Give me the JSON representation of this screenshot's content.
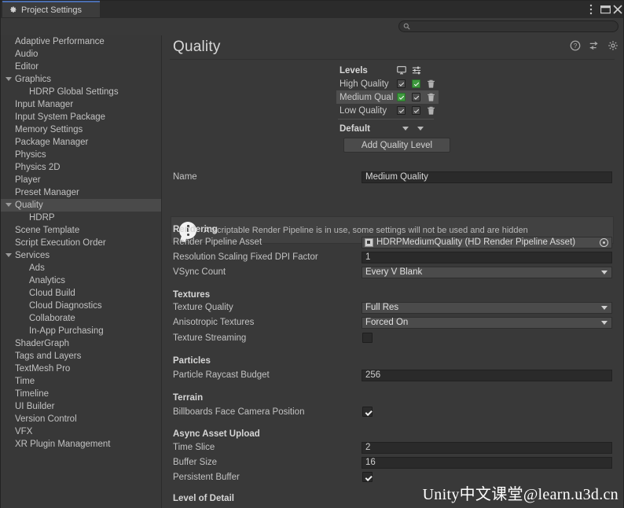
{
  "window": {
    "tab_label": "Project Settings",
    "tab_icon": "gear-icon",
    "controls": [
      {
        "name": "window-menu-icon",
        "glyph": "kebab-menu"
      },
      {
        "name": "window-maximize-icon",
        "glyph": "maximize"
      },
      {
        "name": "window-close-icon",
        "glyph": "close"
      }
    ]
  },
  "search": {
    "value": "",
    "placeholder": "",
    "icon": "search-icon"
  },
  "sidebar": {
    "items": [
      {
        "label": "Adaptive Performance",
        "indent": 0,
        "foldout": false,
        "selected": false
      },
      {
        "label": "Audio",
        "indent": 0,
        "foldout": false,
        "selected": false
      },
      {
        "label": "Editor",
        "indent": 0,
        "foldout": false,
        "selected": false
      },
      {
        "label": "Graphics",
        "indent": 0,
        "foldout": true,
        "selected": false
      },
      {
        "label": "HDRP Global Settings",
        "indent": 1,
        "foldout": false,
        "selected": false
      },
      {
        "label": "Input Manager",
        "indent": 0,
        "foldout": false,
        "selected": false
      },
      {
        "label": "Input System Package",
        "indent": 0,
        "foldout": false,
        "selected": false
      },
      {
        "label": "Memory Settings",
        "indent": 0,
        "foldout": false,
        "selected": false
      },
      {
        "label": "Package Manager",
        "indent": 0,
        "foldout": false,
        "selected": false
      },
      {
        "label": "Physics",
        "indent": 0,
        "foldout": false,
        "selected": false
      },
      {
        "label": "Physics 2D",
        "indent": 0,
        "foldout": false,
        "selected": false
      },
      {
        "label": "Player",
        "indent": 0,
        "foldout": false,
        "selected": false
      },
      {
        "label": "Preset Manager",
        "indent": 0,
        "foldout": false,
        "selected": false
      },
      {
        "label": "Quality",
        "indent": 0,
        "foldout": true,
        "selected": true
      },
      {
        "label": "HDRP",
        "indent": 1,
        "foldout": false,
        "selected": false
      },
      {
        "label": "Scene Template",
        "indent": 0,
        "foldout": false,
        "selected": false
      },
      {
        "label": "Script Execution Order",
        "indent": 0,
        "foldout": false,
        "selected": false
      },
      {
        "label": "Services",
        "indent": 0,
        "foldout": true,
        "selected": false
      },
      {
        "label": "Ads",
        "indent": 1,
        "foldout": false,
        "selected": false
      },
      {
        "label": "Analytics",
        "indent": 1,
        "foldout": false,
        "selected": false
      },
      {
        "label": "Cloud Build",
        "indent": 1,
        "foldout": false,
        "selected": false
      },
      {
        "label": "Cloud Diagnostics",
        "indent": 1,
        "foldout": false,
        "selected": false
      },
      {
        "label": "Collaborate",
        "indent": 1,
        "foldout": false,
        "selected": false
      },
      {
        "label": "In-App Purchasing",
        "indent": 1,
        "foldout": false,
        "selected": false
      },
      {
        "label": "ShaderGraph",
        "indent": 0,
        "foldout": false,
        "selected": false
      },
      {
        "label": "Tags and Layers",
        "indent": 0,
        "foldout": false,
        "selected": false
      },
      {
        "label": "TextMesh Pro",
        "indent": 0,
        "foldout": false,
        "selected": false
      },
      {
        "label": "Time",
        "indent": 0,
        "foldout": false,
        "selected": false
      },
      {
        "label": "Timeline",
        "indent": 0,
        "foldout": false,
        "selected": false
      },
      {
        "label": "UI Builder",
        "indent": 0,
        "foldout": false,
        "selected": false
      },
      {
        "label": "Version Control",
        "indent": 0,
        "foldout": false,
        "selected": false
      },
      {
        "label": "VFX",
        "indent": 0,
        "foldout": false,
        "selected": false
      },
      {
        "label": "XR Plugin Management",
        "indent": 0,
        "foldout": false,
        "selected": false
      }
    ]
  },
  "page": {
    "title": "Quality",
    "header_icons": [
      {
        "name": "help-icon"
      },
      {
        "name": "preset-icon"
      },
      {
        "name": "gear-icon"
      }
    ]
  },
  "levels": {
    "header_label": "Levels",
    "col_icons": [
      {
        "name": "display-icon"
      },
      {
        "name": "settings-sliders-icon"
      }
    ],
    "rows": [
      {
        "name": "High Quality",
        "col1_checked": true,
        "col1_green": false,
        "col2_checked": true,
        "col2_green": true,
        "selected": false
      },
      {
        "name": "Medium Qual",
        "col1_checked": true,
        "col1_green": true,
        "col2_checked": true,
        "col2_green": false,
        "selected": true
      },
      {
        "name": "Low Quality",
        "col1_checked": true,
        "col1_green": false,
        "col2_checked": true,
        "col2_green": false,
        "selected": false
      }
    ],
    "default_label": "Default",
    "add_button_label": "Add Quality Level"
  },
  "form": {
    "name_label": "Name",
    "name_value": "Medium Quality",
    "warning_text": "A Scriptable Render Pipeline is in use, some settings will not be used and are hidden",
    "sections": {
      "rendering": "Rendering",
      "textures": "Textures",
      "particles": "Particles",
      "terrain": "Terrain",
      "async_asset_upload": "Async Asset Upload",
      "level_of_detail": "Level of Detail"
    },
    "render_pipeline_asset": {
      "label": "Render Pipeline Asset",
      "value": "HDRPMediumQuality (HD Render Pipeline Asset)"
    },
    "resolution_scaling": {
      "label": "Resolution Scaling Fixed DPI Factor",
      "value": "1"
    },
    "vsync_count": {
      "label": "VSync Count",
      "value": "Every V Blank"
    },
    "texture_quality": {
      "label": "Texture Quality",
      "value": "Full Res"
    },
    "anisotropic_textures": {
      "label": "Anisotropic Textures",
      "value": "Forced On"
    },
    "texture_streaming": {
      "label": "Texture Streaming",
      "checked": false
    },
    "particle_raycast_budget": {
      "label": "Particle Raycast Budget",
      "value": "256"
    },
    "billboards_face_camera": {
      "label": "Billboards Face Camera Position",
      "checked": true
    },
    "time_slice": {
      "label": "Time Slice",
      "value": "2"
    },
    "buffer_size": {
      "label": "Buffer Size",
      "value": "16"
    },
    "persistent_buffer": {
      "label": "Persistent Buffer",
      "checked": true
    }
  },
  "watermark": {
    "text": "Unity中文课堂@learn.u3d.cn"
  },
  "colors": {
    "background": "#383838",
    "panel": "#393939",
    "selection": "#4a4a4a",
    "accent_tab": "#4b6eaf",
    "green_check": "#3f9a3f"
  }
}
